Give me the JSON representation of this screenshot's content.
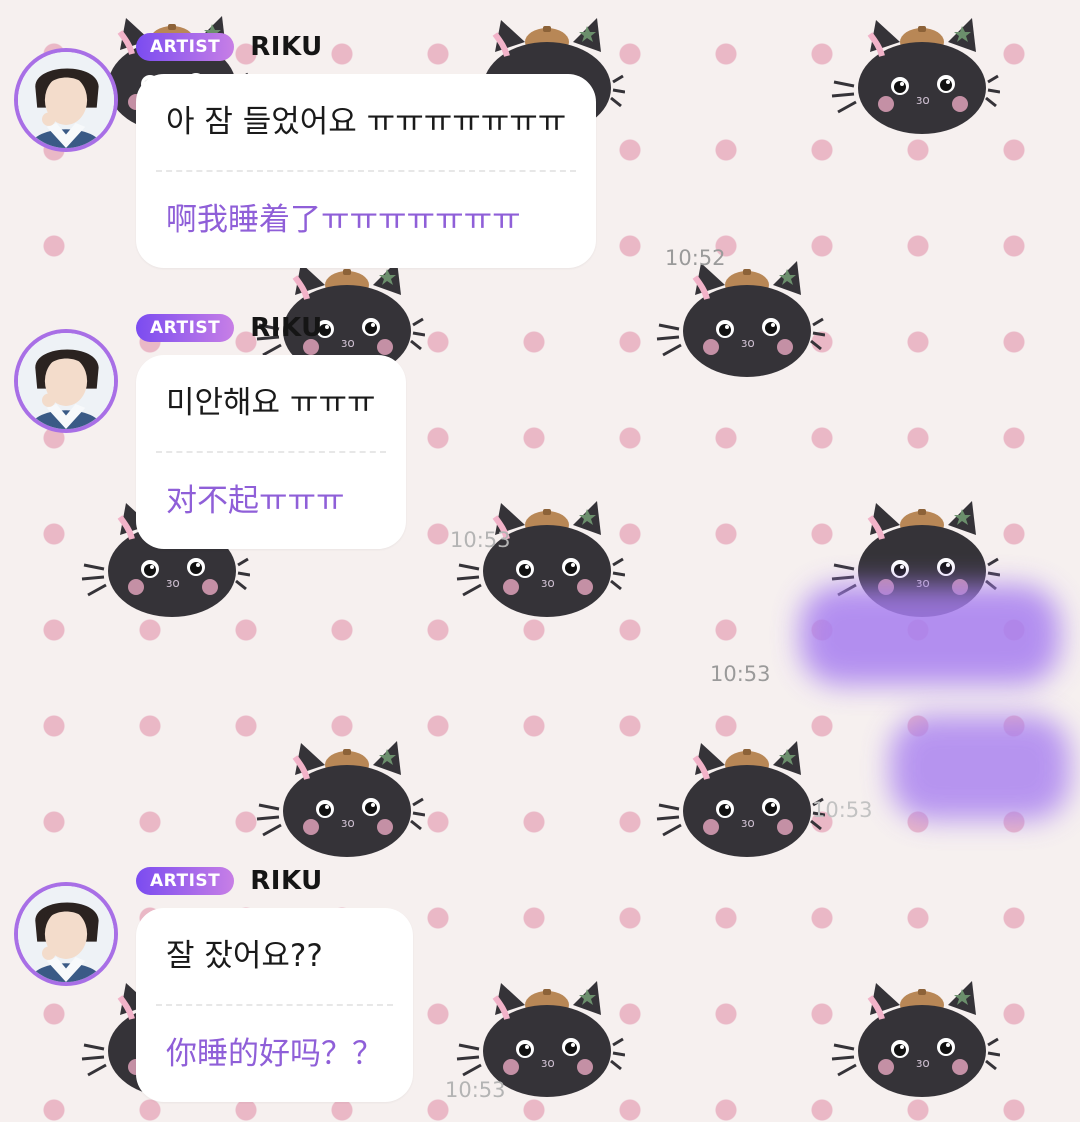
{
  "messages": [
    {
      "badge": "ARTIST",
      "sender": "RIKU",
      "text_ko": "아 잠 들었어요 ㅠㅠㅠㅠㅠㅠㅠ",
      "text_zh": "啊我睡着了ㅠㅠㅠㅠㅠㅠㅠ",
      "time": "10:52"
    },
    {
      "badge": "ARTIST",
      "sender": "RIKU",
      "text_ko": "미안해요 ㅠㅠㅠ",
      "text_zh": "对不起ㅠㅠㅠ",
      "time": "10:53"
    },
    {
      "badge": "ARTIST",
      "sender": "RIKU",
      "text_ko": "잘 잤어요??",
      "text_zh": "你睡的好吗？？",
      "time": "10:53"
    }
  ],
  "own_messages": [
    {
      "time": "10:53"
    },
    {
      "time": "10:53"
    }
  ],
  "colors": {
    "accent_purple": "#8f5fd8",
    "badge_gradient_start": "#7b4cf0",
    "badge_gradient_end": "#c77fe6",
    "redaction": "#a77ef0",
    "background": "#f6f0ef",
    "polka_dot": "#eab8c6"
  },
  "icons": {
    "background_pattern": "black-cat-with-beret-icon",
    "avatar": "profile-photo"
  }
}
